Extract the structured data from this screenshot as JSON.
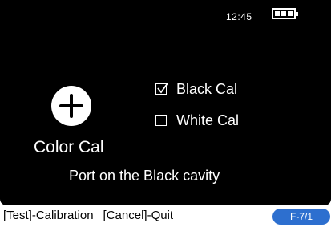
{
  "status_bar": {
    "time": "12:45",
    "battery_icon": "battery-full-icon"
  },
  "color_cal": {
    "icon": "plus-icon",
    "label": "Color Cal"
  },
  "options": [
    {
      "label": "Black Cal",
      "checked": true
    },
    {
      "label": "White Cal",
      "checked": false
    }
  ],
  "message": "Port on the Black cavity",
  "footer": {
    "test_hint": "[Test]-Calibration",
    "cancel_hint": "[Cancel]-Quit",
    "page_code": "F-7/1"
  },
  "colors": {
    "screen_bg": "#000000",
    "foreground": "#ffffff",
    "badge": "#2d6fcf"
  }
}
